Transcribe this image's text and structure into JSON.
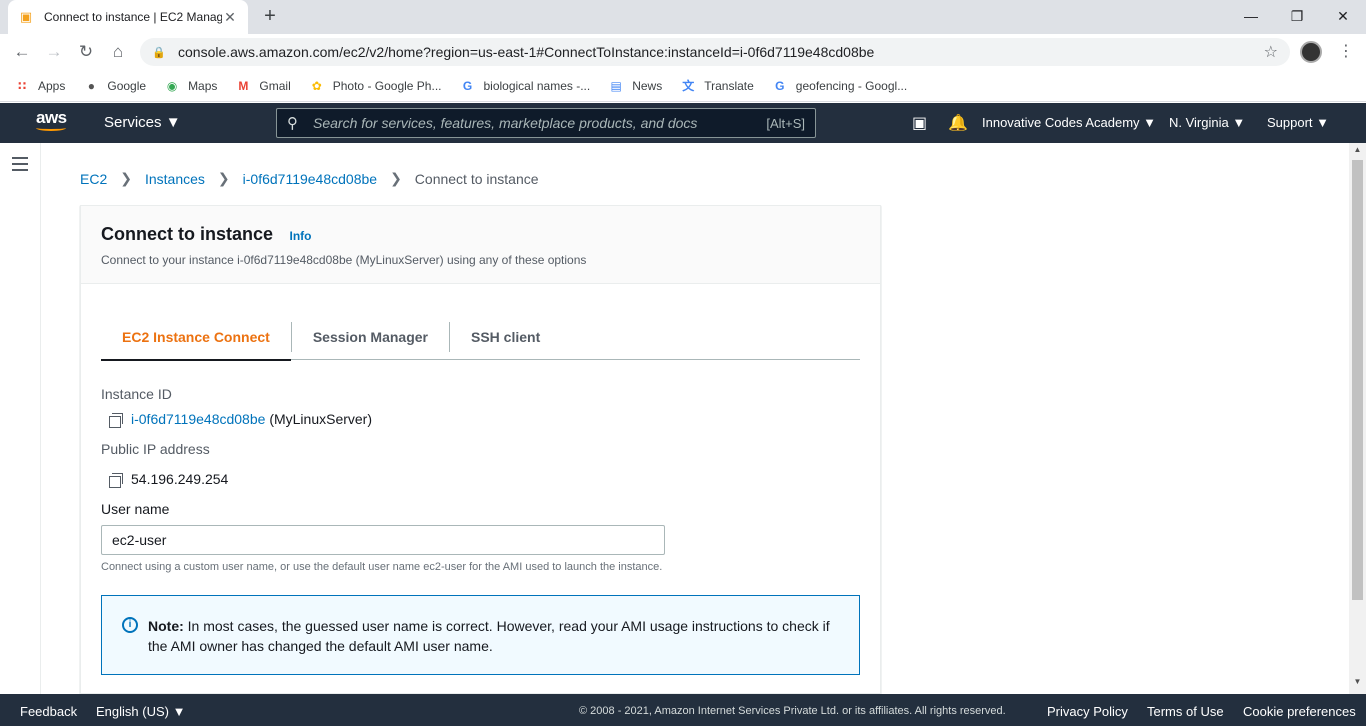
{
  "browser": {
    "tab_title": "Connect to instance | EC2 Manag",
    "url": "console.aws.amazon.com/ec2/v2/home?region=us-east-1#ConnectToInstance:instanceId=i-0f6d7119e48cd08be",
    "bookmarks": [
      "Apps",
      "Google",
      "Maps",
      "Gmail",
      "Photo - Google Ph...",
      "biological names -...",
      "News",
      "Translate",
      "geofencing - Googl..."
    ]
  },
  "aws_nav": {
    "logo": "aws",
    "services": "Services",
    "search_placeholder": "Search for services, features, marketplace products, and docs",
    "search_shortcut": "[Alt+S]",
    "account": "Innovative Codes Academy",
    "region": "N. Virginia",
    "support": "Support"
  },
  "breadcrumb": [
    "EC2",
    "Instances",
    "i-0f6d7119e48cd08be",
    "Connect to instance"
  ],
  "panel": {
    "title": "Connect to instance",
    "info": "Info",
    "description": "Connect to your instance i-0f6d7119e48cd08be (MyLinuxServer) using any of these options",
    "tabs": [
      "EC2 Instance Connect",
      "Session Manager",
      "SSH client"
    ],
    "instance_id_label": "Instance ID",
    "instance_id": "i-0f6d7119e48cd08be",
    "instance_name": "(MyLinuxServer)",
    "public_ip_label": "Public IP address",
    "public_ip": "54.196.249.254",
    "username_label": "User name",
    "username_value": "ec2-user",
    "username_hint": "Connect using a custom user name, or use the default user name ec2-user for the AMI used to launch the instance.",
    "note_label": "Note:",
    "note_text": "In most cases, the guessed user name is correct. However, read your AMI usage instructions to check if the AMI owner has changed the default AMI user name."
  },
  "footer": {
    "feedback": "Feedback",
    "language": "English (US)",
    "copyright": "© 2008 - 2021, Amazon Internet Services Private Ltd. or its affiliates. All rights reserved.",
    "privacy": "Privacy Policy",
    "terms": "Terms of Use",
    "cookies": "Cookie preferences"
  },
  "colors": {
    "aws_nav_bg": "#232f3e",
    "link": "#0073bb",
    "active_tab": "#ec7211"
  }
}
